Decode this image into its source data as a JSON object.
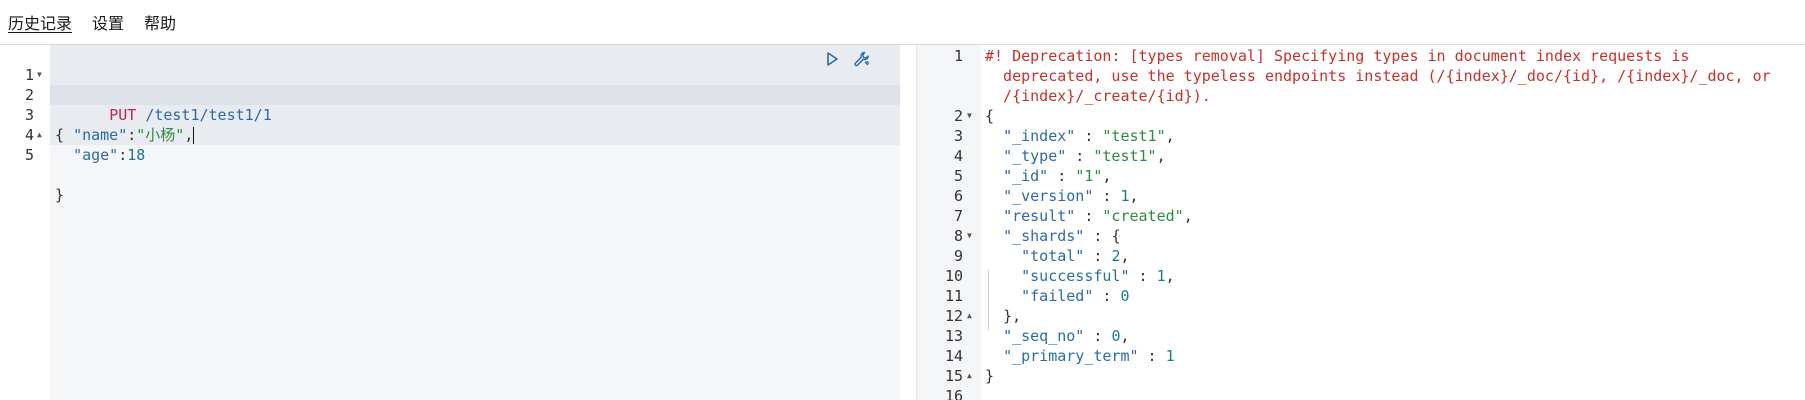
{
  "menu": {
    "history": "历史记录",
    "settings": "设置",
    "help": "帮助"
  },
  "request": {
    "method": "PUT",
    "url": "/test1/test1/1",
    "lines": [
      {
        "n": "1"
      },
      {
        "n": "2",
        "text": "{"
      },
      {
        "n": "3",
        "key": "\"name\"",
        "val": "\"小杨\""
      },
      {
        "n": "4",
        "key": "\"age\"",
        "val": "18"
      },
      {
        "n": "5",
        "text": "}"
      }
    ],
    "actions": {
      "run_icon": "play-icon",
      "settings_icon": "wrench-icon"
    }
  },
  "response": {
    "deprecation": [
      "#! Deprecation: [types removal] Specifying types in document index requests is",
      "  deprecated, use the typeless endpoints instead (/{index}/_doc/{id}, /{index}/_doc, or",
      "  /{index}/_create/{id})."
    ],
    "line_numbers": [
      "1",
      "2",
      "3",
      "4",
      "5",
      "6",
      "7",
      "8",
      "9",
      "10",
      "11",
      "12",
      "13",
      "14",
      "15",
      "16"
    ],
    "body": [
      {
        "indent": 0,
        "text": "{"
      },
      {
        "indent": 1,
        "key": "\"_index\"",
        "val": "\"test1\"",
        "type": "str",
        "comma": true
      },
      {
        "indent": 1,
        "key": "\"_type\"",
        "val": "\"test1\"",
        "type": "str",
        "comma": true
      },
      {
        "indent": 1,
        "key": "\"_id\"",
        "val": "\"1\"",
        "type": "str",
        "comma": true
      },
      {
        "indent": 1,
        "key": "\"_version\"",
        "val": "1",
        "type": "num",
        "comma": true
      },
      {
        "indent": 1,
        "key": "\"result\"",
        "val": "\"created\"",
        "type": "str",
        "comma": true
      },
      {
        "indent": 1,
        "key": "\"_shards\"",
        "val": "{",
        "type": "punct",
        "comma": false
      },
      {
        "indent": 2,
        "key": "\"total\"",
        "val": "2",
        "type": "num",
        "comma": true
      },
      {
        "indent": 2,
        "key": "\"successful\"",
        "val": "1",
        "type": "num",
        "comma": true
      },
      {
        "indent": 2,
        "key": "\"failed\"",
        "val": "0",
        "type": "num",
        "comma": false
      },
      {
        "indent": 1,
        "text": "},"
      },
      {
        "indent": 1,
        "key": "\"_seq_no\"",
        "val": "0",
        "type": "num",
        "comma": true
      },
      {
        "indent": 1,
        "key": "\"_primary_term\"",
        "val": "1",
        "type": "num",
        "comma": false
      },
      {
        "indent": 0,
        "text": "}"
      }
    ]
  }
}
